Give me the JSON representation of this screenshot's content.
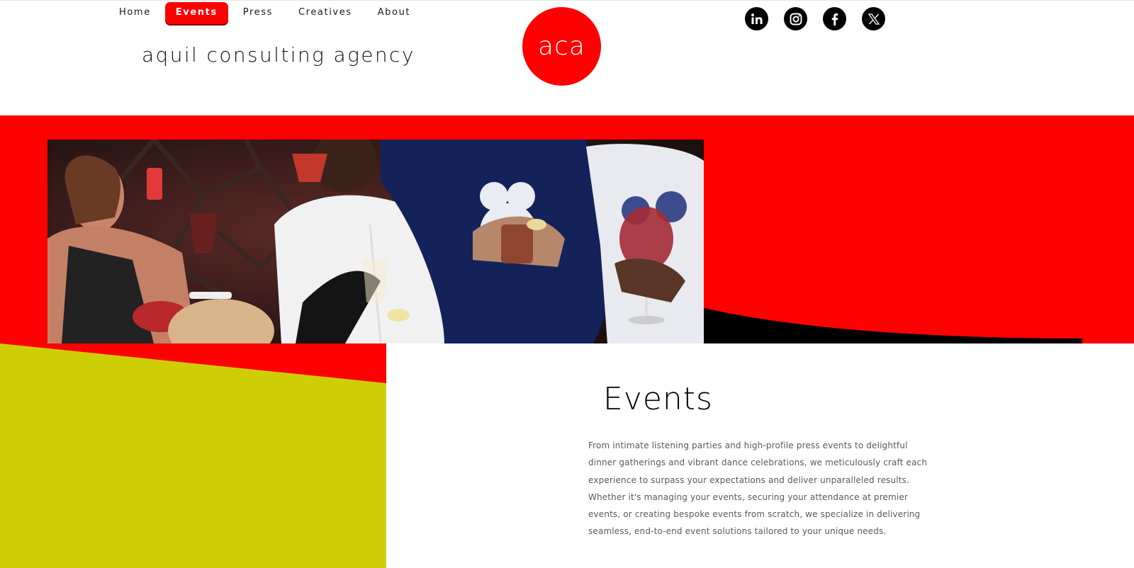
{
  "nav": {
    "items": [
      {
        "label": "Home"
      },
      {
        "label": "Events",
        "active": true
      },
      {
        "label": "Press"
      },
      {
        "label": "Creatives"
      },
      {
        "label": "About"
      }
    ]
  },
  "brand": {
    "name": "aquil consulting agency",
    "logo_text": "aca"
  },
  "social": [
    {
      "icon": "linkedin-icon"
    },
    {
      "icon": "instagram-icon"
    },
    {
      "icon": "facebook-icon"
    },
    {
      "icon": "x-icon"
    }
  ],
  "hero": {
    "image_alt": "event-photo"
  },
  "events": {
    "title": "Events",
    "body": "From intimate listening parties and high-profile press events to delightful dinner gatherings and vibrant dance celebrations, we meticulously craft each experience to surpass your expectations and deliver unparalleled results. Whether it's managing your events, securing your attendance at premier events, or creating bespoke events from scratch, we specialize in delivering seamless, end-to-end event solutions tailored to your unique needs."
  },
  "colors": {
    "accent_red": "#ff0000",
    "accent_lime": "#cece07",
    "black": "#000000",
    "white": "#ffffff"
  }
}
